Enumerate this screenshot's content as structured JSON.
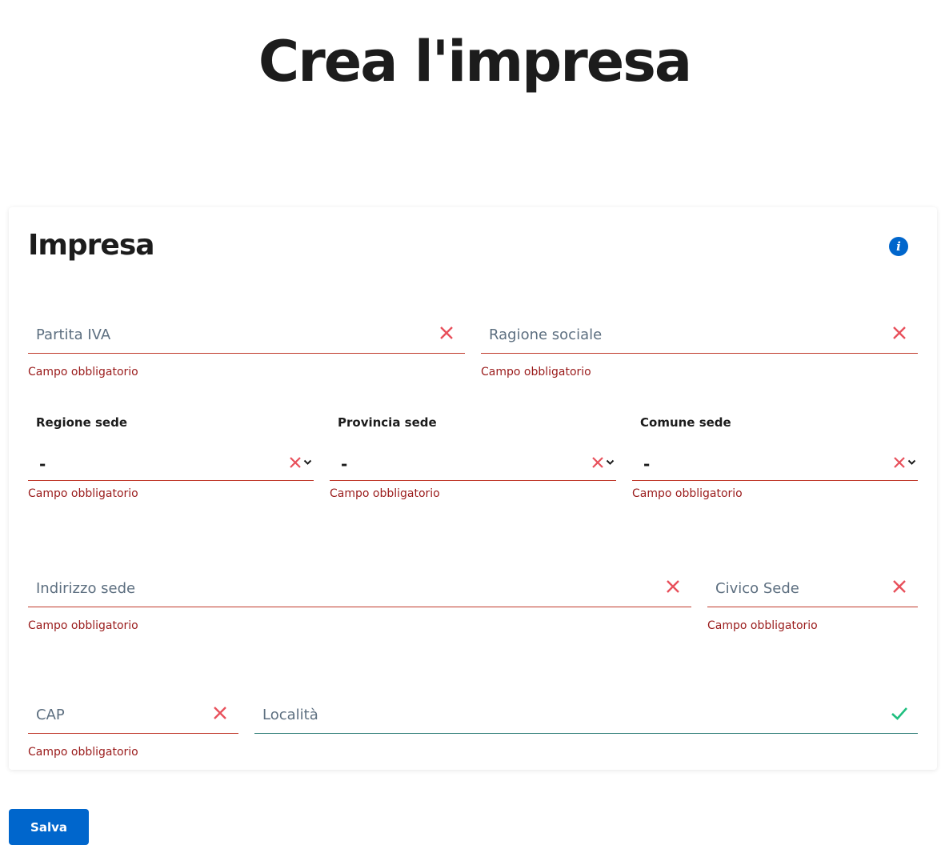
{
  "page": {
    "title": "Crea l'impresa"
  },
  "card": {
    "title": "Impresa",
    "info_icon": "info-circle-icon",
    "fields": {
      "partita_iva": {
        "placeholder": "Partita IVA",
        "error": "Campo obbligatorio",
        "status": "invalid"
      },
      "ragione_sociale": {
        "placeholder": "Ragione sociale",
        "error": "Campo obbligatorio",
        "status": "invalid"
      },
      "regione_sede": {
        "label": "Regione sede",
        "value": "-",
        "error": "Campo obbligatorio",
        "status": "invalid"
      },
      "provincia_sede": {
        "label": "Provincia sede",
        "value": "-",
        "error": "Campo obbligatorio",
        "status": "invalid"
      },
      "comune_sede": {
        "label": "Comune sede",
        "value": "-",
        "error": "Campo obbligatorio",
        "status": "invalid"
      },
      "indirizzo_sede": {
        "placeholder": "Indirizzo sede",
        "error": "Campo obbligatorio",
        "status": "invalid"
      },
      "civico_sede": {
        "placeholder": "Civico Sede",
        "error": "Campo obbligatorio",
        "status": "invalid"
      },
      "cap": {
        "placeholder": "CAP",
        "error": "Campo obbligatorio",
        "status": "invalid"
      },
      "localita": {
        "placeholder": "Località",
        "status": "valid"
      }
    }
  },
  "actions": {
    "save_label": "Salva"
  },
  "colors": {
    "primary": "#0066cc",
    "error": "#9a1b1b",
    "invalid_mark": "#e8505b",
    "valid_mark": "#1fbf7f"
  }
}
